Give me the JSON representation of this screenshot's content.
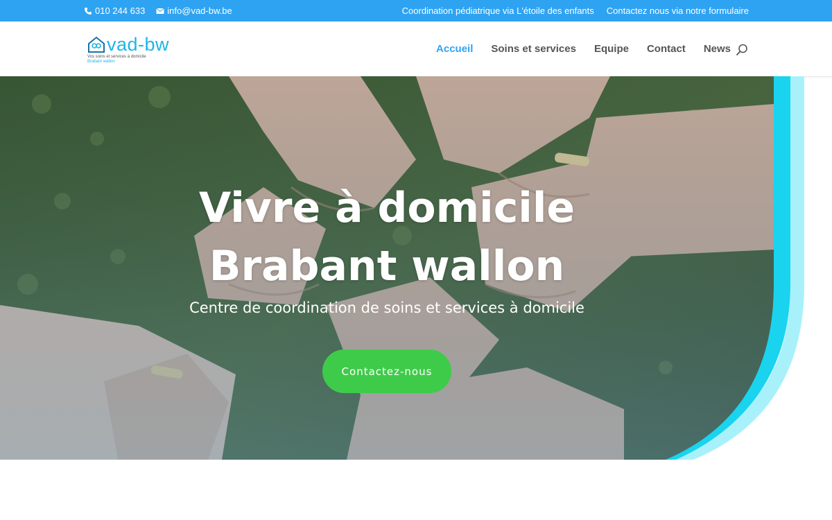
{
  "topbar": {
    "phone": "010 244 633",
    "email": "info@vad-bw.be",
    "links": [
      "Coordination pédiatrique via L'étoile des enfants",
      "Contactez nous via notre formulaire"
    ]
  },
  "logo": {
    "brand": "vad-bw",
    "tagline": "Vos soins et services à domicile",
    "region": "Brabant wallon"
  },
  "nav": {
    "items": [
      "Accueil",
      "Soins et services",
      "Equipe",
      "Contact",
      "News"
    ],
    "active": "Accueil"
  },
  "hero": {
    "title_line1": "Vivre à domicile",
    "title_line2": "Brabant wallon",
    "subtitle": "Centre de coordination de soins et services à domicile",
    "cta": "Contactez-nous"
  },
  "colors": {
    "topbar": "#2ea3f2",
    "accent": "#2ea3f2",
    "cta": "#3fcb4a",
    "arc_outer": "#a8f1fb",
    "arc_inner": "#1ad3ee"
  },
  "icons": {
    "phone": "phone-icon",
    "email": "envelope-icon",
    "search": "search-icon"
  }
}
